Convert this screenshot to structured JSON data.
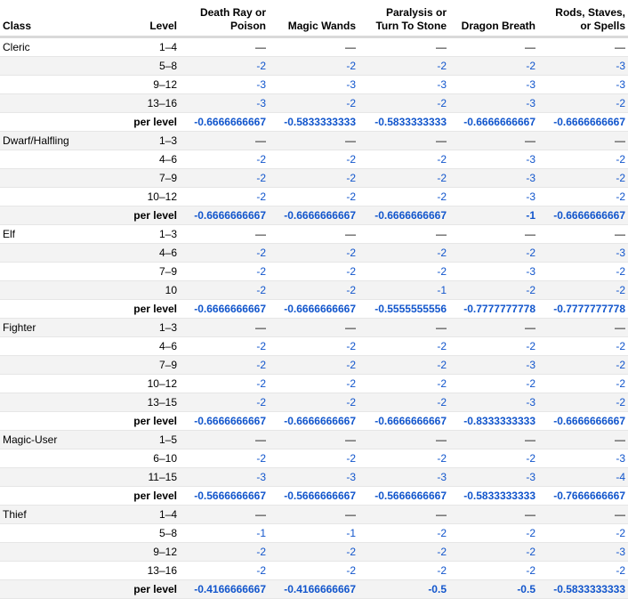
{
  "header": {
    "class": "Class",
    "level": "Level",
    "saves": [
      "Death Ray or\nPoison",
      "Magic Wands",
      "Paralysis or\nTurn To Stone",
      "Dragon Breath",
      "Rods, Staves,\nor Spells"
    ]
  },
  "groups": [
    {
      "name": "Cleric",
      "rows": [
        {
          "level": "1–4",
          "values": [
            "—",
            "—",
            "—",
            "—",
            "—"
          ]
        },
        {
          "level": "5–8",
          "values": [
            "-2",
            "-2",
            "-2",
            "-2",
            "-3"
          ]
        },
        {
          "level": "9–12",
          "values": [
            "-3",
            "-3",
            "-3",
            "-3",
            "-3"
          ]
        },
        {
          "level": "13–16",
          "values": [
            "-3",
            "-2",
            "-2",
            "-3",
            "-2"
          ]
        },
        {
          "level": "per level",
          "per": true,
          "values": [
            "-0.6666666667",
            "-0.5833333333",
            "-0.5833333333",
            "-0.6666666667",
            "-0.6666666667"
          ]
        }
      ]
    },
    {
      "name": "Dwarf/Halfling",
      "rows": [
        {
          "level": "1–3",
          "values": [
            "—",
            "—",
            "—",
            "—",
            "—"
          ]
        },
        {
          "level": "4–6",
          "values": [
            "-2",
            "-2",
            "-2",
            "-3",
            "-2"
          ]
        },
        {
          "level": "7–9",
          "values": [
            "-2",
            "-2",
            "-2",
            "-3",
            "-2"
          ]
        },
        {
          "level": "10–12",
          "values": [
            "-2",
            "-2",
            "-2",
            "-3",
            "-2"
          ]
        },
        {
          "level": "per level",
          "per": true,
          "values": [
            "-0.6666666667",
            "-0.6666666667",
            "-0.6666666667",
            "-1",
            "-0.6666666667"
          ]
        }
      ]
    },
    {
      "name": "Elf",
      "rows": [
        {
          "level": "1–3",
          "values": [
            "—",
            "—",
            "—",
            "—",
            "—"
          ]
        },
        {
          "level": "4–6",
          "values": [
            "-2",
            "-2",
            "-2",
            "-2",
            "-3"
          ]
        },
        {
          "level": "7–9",
          "values": [
            "-2",
            "-2",
            "-2",
            "-3",
            "-2"
          ]
        },
        {
          "level": "10",
          "values": [
            "-2",
            "-2",
            "-1",
            "-2",
            "-2"
          ]
        },
        {
          "level": "per level",
          "per": true,
          "values": [
            "-0.6666666667",
            "-0.6666666667",
            "-0.5555555556",
            "-0.7777777778",
            "-0.7777777778"
          ]
        }
      ]
    },
    {
      "name": "Fighter",
      "rows": [
        {
          "level": "1–3",
          "values": [
            "—",
            "—",
            "—",
            "—",
            "—"
          ]
        },
        {
          "level": "4–6",
          "values": [
            "-2",
            "-2",
            "-2",
            "-2",
            "-2"
          ]
        },
        {
          "level": "7–9",
          "values": [
            "-2",
            "-2",
            "-2",
            "-3",
            "-2"
          ]
        },
        {
          "level": "10–12",
          "values": [
            "-2",
            "-2",
            "-2",
            "-2",
            "-2"
          ]
        },
        {
          "level": "13–15",
          "values": [
            "-2",
            "-2",
            "-2",
            "-3",
            "-2"
          ]
        },
        {
          "level": "per level",
          "per": true,
          "values": [
            "-0.6666666667",
            "-0.6666666667",
            "-0.6666666667",
            "-0.8333333333",
            "-0.6666666667"
          ]
        }
      ]
    },
    {
      "name": "Magic-User",
      "rows": [
        {
          "level": "1–5",
          "values": [
            "—",
            "—",
            "—",
            "—",
            "—"
          ]
        },
        {
          "level": "6–10",
          "values": [
            "-2",
            "-2",
            "-2",
            "-2",
            "-3"
          ]
        },
        {
          "level": "11–15",
          "values": [
            "-3",
            "-3",
            "-3",
            "-3",
            "-4"
          ]
        },
        {
          "level": "per level",
          "per": true,
          "values": [
            "-0.5666666667",
            "-0.5666666667",
            "-0.5666666667",
            "-0.5833333333",
            "-0.7666666667"
          ]
        }
      ]
    },
    {
      "name": "Thief",
      "rows": [
        {
          "level": "1–4",
          "values": [
            "—",
            "—",
            "—",
            "—",
            "—"
          ]
        },
        {
          "level": "5–8",
          "values": [
            "-1",
            "-1",
            "-2",
            "-2",
            "-2"
          ]
        },
        {
          "level": "9–12",
          "values": [
            "-2",
            "-2",
            "-2",
            "-2",
            "-3"
          ]
        },
        {
          "level": "13–16",
          "values": [
            "-2",
            "-2",
            "-2",
            "-2",
            "-2"
          ]
        },
        {
          "level": "per level",
          "per": true,
          "values": [
            "-0.4166666667",
            "-0.4166666667",
            "-0.5",
            "-0.5",
            "-0.5833333333"
          ]
        }
      ]
    }
  ]
}
